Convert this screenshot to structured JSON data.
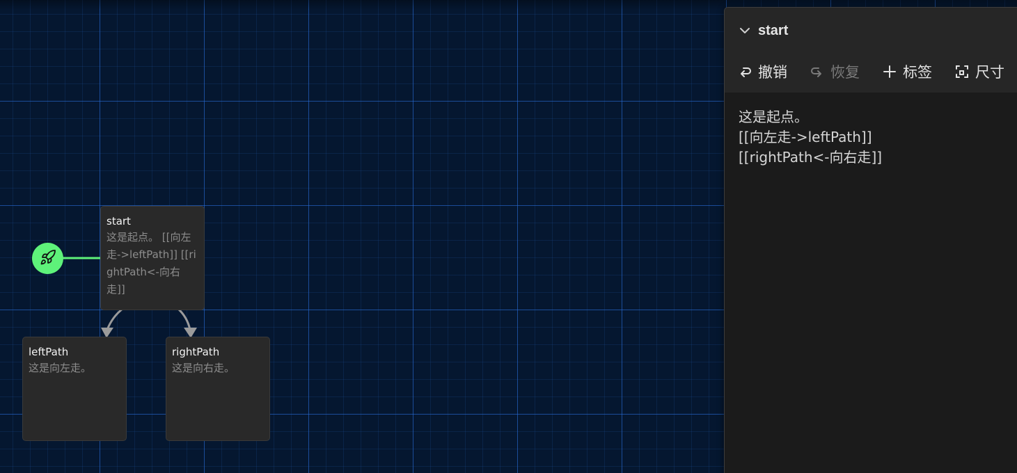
{
  "passages": {
    "start": {
      "name": "start",
      "excerpt": "这是起点。 [[向左走->leftPath]] [[rightPath<-向右走]]"
    },
    "left": {
      "name": "leftPath",
      "excerpt": "这是向左走。"
    },
    "right": {
      "name": "rightPath",
      "excerpt": "这是向右走。"
    }
  },
  "icons": {
    "start_marker": "rocket-icon",
    "collapse": "chevron-down-icon",
    "undo": "undo-icon",
    "redo": "redo-icon",
    "tag": "plus-icon",
    "size": "size-icon"
  },
  "colors": {
    "canvas": "#051730",
    "grid": "#286edc",
    "start_marker": "#5ef27a",
    "card": "#292929",
    "dialog": "#1b1b1b"
  },
  "dialog": {
    "title": "start",
    "toolbar": {
      "undo": "撤销",
      "redo": "恢复",
      "tag": "标签",
      "size": "尺寸"
    },
    "text_lines": [
      "这是起点。",
      "[[向左走->leftPath]]",
      "[[rightPath<-向右走]]"
    ]
  }
}
